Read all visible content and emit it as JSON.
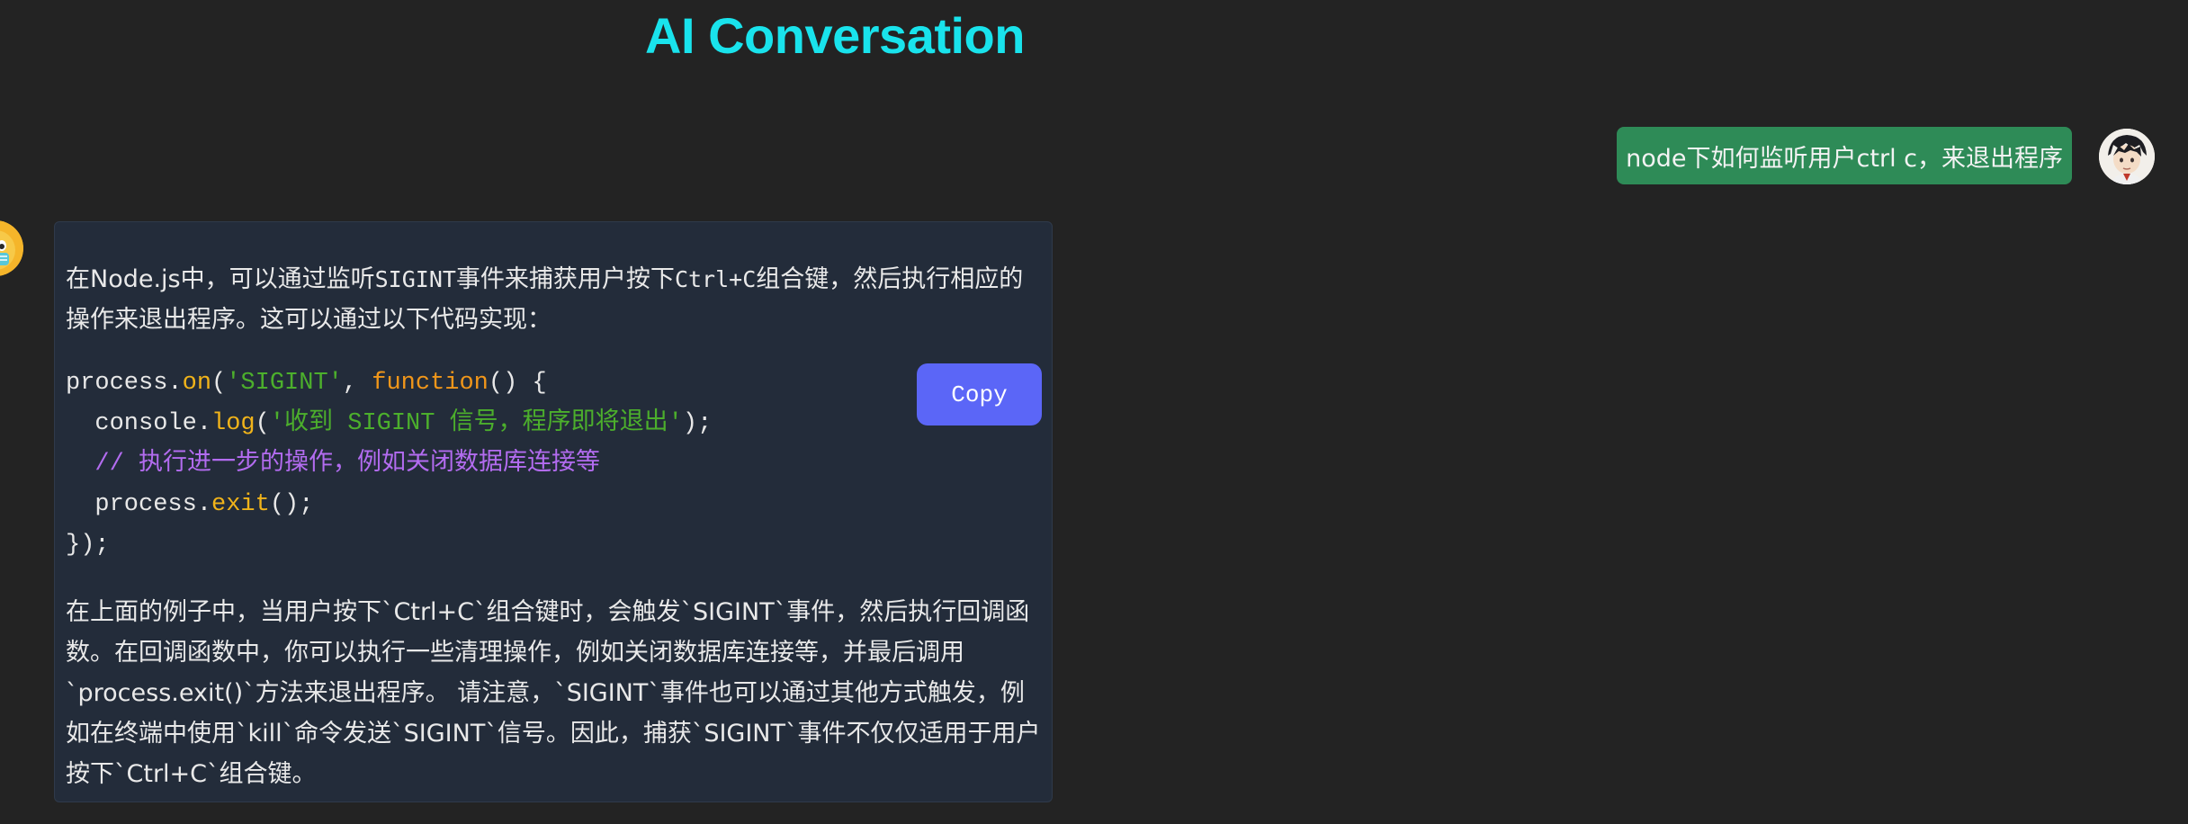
{
  "page": {
    "title": "AI Conversation"
  },
  "user_message": {
    "text": "node下如何监听用户ctrl c，来退出程序",
    "avatar_icon": "user-avatar-icon",
    "bubble_color": "#2e8b57"
  },
  "bot_message": {
    "avatar_icon": "bot-avatar-icon",
    "intro": {
      "part1": "在Node.js中，可以通过监听",
      "code1": "SIGINT",
      "part2": "事件来捕获用户按下",
      "code2": "Ctrl+C",
      "part3": "组合键，然后执行相应的操作来退出程序。这可以通过以下代码实现："
    },
    "code": {
      "line1": {
        "a": "process.",
        "b": "on",
        "c": "(",
        "d": "'SIGINT'",
        "e": ", ",
        "f": "function",
        "g": "() {"
      },
      "line2": {
        "a": "  console.",
        "b": "log",
        "c": "(",
        "d": "'收到 SIGINT 信号，程序即将退出'",
        "e": ");"
      },
      "line3": {
        "a": "  ",
        "b": "// 执行进一步的操作，例如关闭数据库连接等"
      },
      "line4": {
        "a": "  process.",
        "b": "exit",
        "c": "();"
      },
      "line5": {
        "a": "});"
      }
    },
    "copy_label": "Copy",
    "outro": "在上面的例子中，当用户按下`Ctrl+C`组合键时，会触发`SIGINT`事件，然后执行回调函数。在回调函数中，你可以执行一些清理操作，例如关闭数据库连接等，并最后调用`process.exit()`方法来退出程序。 请注意，`SIGINT`事件也可以通过其他方式触发，例如在终端中使用`kill`命令发送`SIGINT`信号。因此，捕获`SIGINT`事件不仅仅适用于用户按下`Ctrl+C`组合键。"
  },
  "colors": {
    "background": "#232323",
    "title": "#19e3ec",
    "card": "#232c3a",
    "copy_button": "#5b66f7"
  }
}
